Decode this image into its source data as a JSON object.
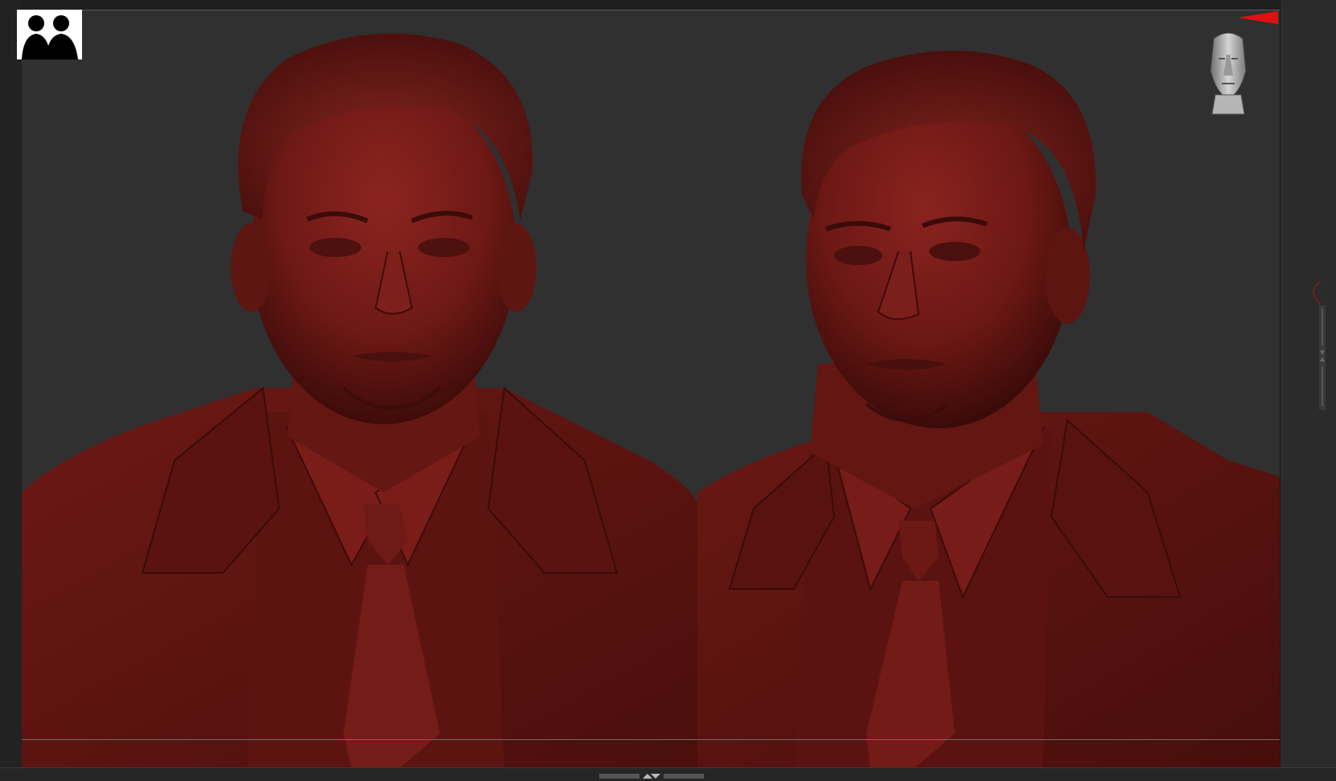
{
  "app": {
    "name": ""
  },
  "viewport": {
    "background_color": "#303030",
    "material_color": "#6b1a17",
    "models": [
      {
        "id": "left",
        "view": "front",
        "subject": "male-bust"
      },
      {
        "id": "right",
        "view": "three-quarter",
        "subject": "male-bust"
      }
    ]
  },
  "widgets": {
    "thumbnail": {
      "icon": "two-silhouettes-icon"
    },
    "nav_cube": {
      "icon": "head-nav-icon"
    },
    "gizmo": {
      "x_color": "#e01010",
      "y_color": "#10c010",
      "z_color": "#1010e0"
    }
  }
}
